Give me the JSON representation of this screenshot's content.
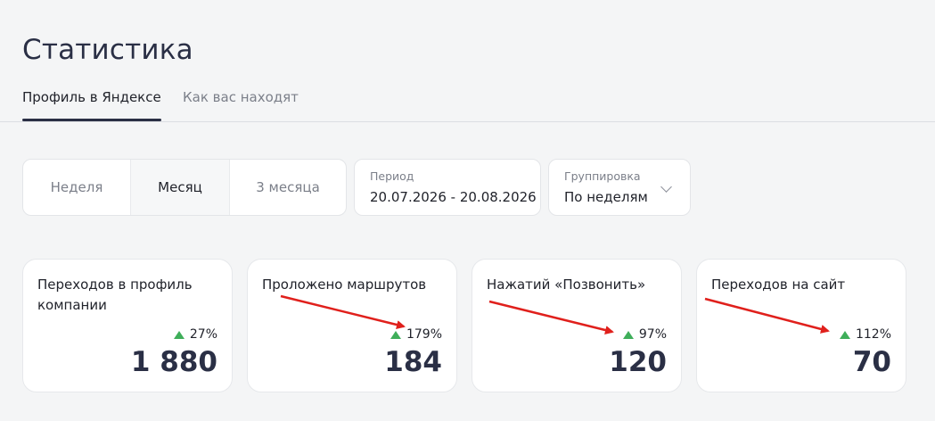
{
  "header": {
    "title": "Статистика"
  },
  "tabs": [
    {
      "label": "Профиль в Яндексе",
      "active": true
    },
    {
      "label": "Как вас находят",
      "active": false
    }
  ],
  "period_selector": {
    "options": [
      "Неделя",
      "Месяц",
      "3 месяца"
    ],
    "selected": "Месяц"
  },
  "period": {
    "label": "Период",
    "value": "20.07.2026 - 20.08.2026"
  },
  "grouping": {
    "label": "Группировка",
    "value": "По неделям",
    "icon": "chevron-down-icon"
  },
  "cards": [
    {
      "title": "Переходов в профиль компании",
      "delta": "27%",
      "value": "1 880"
    },
    {
      "title": "Проложено маршрутов",
      "delta": "179%",
      "value": "184"
    },
    {
      "title": "Нажатий «Позвонить»",
      "delta": "97%",
      "value": "120"
    },
    {
      "title": "Переходов на сайт",
      "delta": "112%",
      "value": "70"
    }
  ],
  "colors": {
    "positive": "#3fae5a",
    "annotation_arrow": "#e0201c",
    "title": "#2a2f45"
  }
}
